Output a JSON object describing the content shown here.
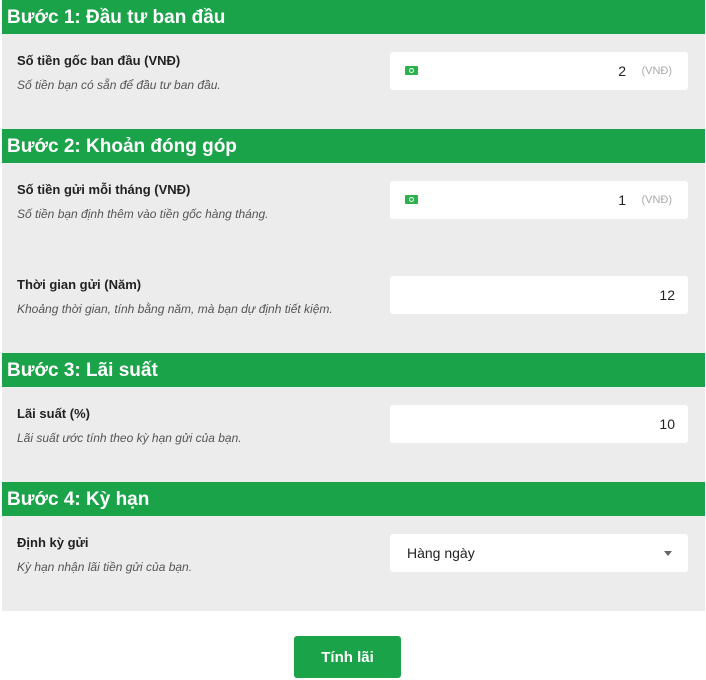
{
  "steps": [
    {
      "header": "Bước 1: Đầu tư ban đầu",
      "fields": [
        {
          "title": "Số tiền gốc ban đầu (VNĐ)",
          "desc": "Số tiền bạn có sẵn để đầu tư ban đầu.",
          "value": "2",
          "unit": "(VNĐ)",
          "icon": "money-icon"
        }
      ]
    },
    {
      "header": "Bước 2: Khoản đóng góp",
      "fields": [
        {
          "title": "Số tiền gửi mỗi tháng (VNĐ)",
          "desc": "Số tiền bạn định thêm vào tiền gốc hàng tháng.",
          "value": "1",
          "unit": "(VNĐ)",
          "icon": "money-icon"
        },
        {
          "title": "Thời gian gửi (Năm)",
          "desc": "Khoảng thời gian, tính bằng năm, mà bạn dự định tiết kiệm.",
          "value": "12"
        }
      ]
    },
    {
      "header": "Bước 3: Lãi suất",
      "fields": [
        {
          "title": "Lãi suất (%)",
          "desc": "Lãi suất ước tính theo kỳ hạn gửi của bạn.",
          "value": "10"
        }
      ]
    },
    {
      "header": "Bước 4: Kỳ hạn",
      "fields": [
        {
          "title": "Định kỳ gửi",
          "desc": "Kỳ hạn nhận lãi tiền gửi của bạn.",
          "selected": "Hàng ngày"
        }
      ]
    }
  ],
  "calculate_button": "Tính lãi",
  "colors": {
    "accent": "#1ba34a",
    "section_bg": "#ececec"
  }
}
